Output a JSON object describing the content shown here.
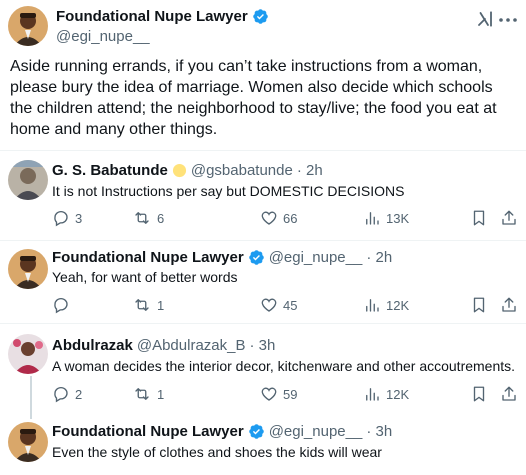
{
  "main_post": {
    "author_name": "Foundational Nupe Lawyer",
    "author_handle": "@egi_nupe__",
    "text": "Aside running errands, if you can’t take instructions from a woman, please bury the idea of marriage. Women also decide which schools the children attend; the neighborhood to stay/live; the food you eat at home and many other things.",
    "icons": [
      "verified-badge-icon",
      "grok-icon",
      "more-options-icon"
    ]
  },
  "replies": [
    {
      "name": "G. S. Babatunde",
      "has_emoji": true,
      "handle": "@gsbabatunde",
      "time": "· 2h",
      "text": "It is not Instructions per say but DOMESTIC DECISIONS",
      "replies": "3",
      "reposts": "6",
      "likes": "66",
      "views": "13K"
    },
    {
      "name": "Foundational Nupe Lawyer",
      "verified": true,
      "handle": "@egi_nupe__",
      "time": "· 2h",
      "text": "Yeah, for want of better words",
      "replies": "",
      "reposts": "1",
      "likes": "45",
      "views": "12K"
    },
    {
      "name": "Abdulrazak",
      "handle": "@Abdulrazak_B",
      "time": "· 3h",
      "text": "A woman decides the interior decor, kitchenware and other accoutrements.",
      "replies": "2",
      "reposts": "1",
      "likes": "59",
      "views": "12K"
    },
    {
      "name": "Foundational Nupe Lawyer",
      "verified": true,
      "handle": "@egi_nupe__",
      "time": "· 3h",
      "text": "Even the style of clothes and shoes the kids will wear"
    }
  ],
  "colors": {
    "text": "#0f1419",
    "secondary": "#536471",
    "verified": "#1d9bf0",
    "divider": "#eff3f4",
    "thread_line": "#cfd9de"
  }
}
